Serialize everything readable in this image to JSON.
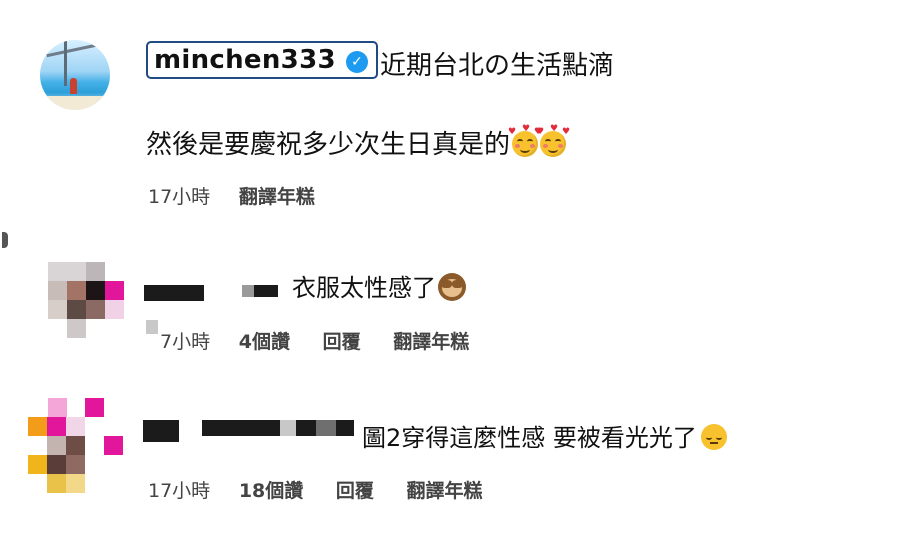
{
  "post": {
    "username": "minchen333",
    "verified_icon": "verified-badge-icon",
    "caption_line1": "近期台北の生活點滴",
    "caption_line2": "然後是要慶祝多少次生日真是的",
    "caption_emoji": "smiling-face-with-hearts-icon",
    "time": "17小時",
    "translate": "翻譯年糕"
  },
  "comments": [
    {
      "text": "衣服太性感了",
      "emoji": "see-no-evil-monkey-icon",
      "time": "7小時",
      "likes": "4個讚",
      "reply": "回覆",
      "translate": "翻譯年糕"
    },
    {
      "text": "圖2穿得這麼性感 要被看光光了",
      "emoji": "pensive-face-icon",
      "time": "17小時",
      "likes": "18個讚",
      "reply": "回覆",
      "translate": "翻譯年糕"
    }
  ],
  "colors": {
    "highlight_border": "#1f4a82",
    "verified": "#1d9bf0",
    "meta_text": "#444444",
    "accent_magenta": "#e2169a",
    "accent_orange": "#f39c1a"
  }
}
